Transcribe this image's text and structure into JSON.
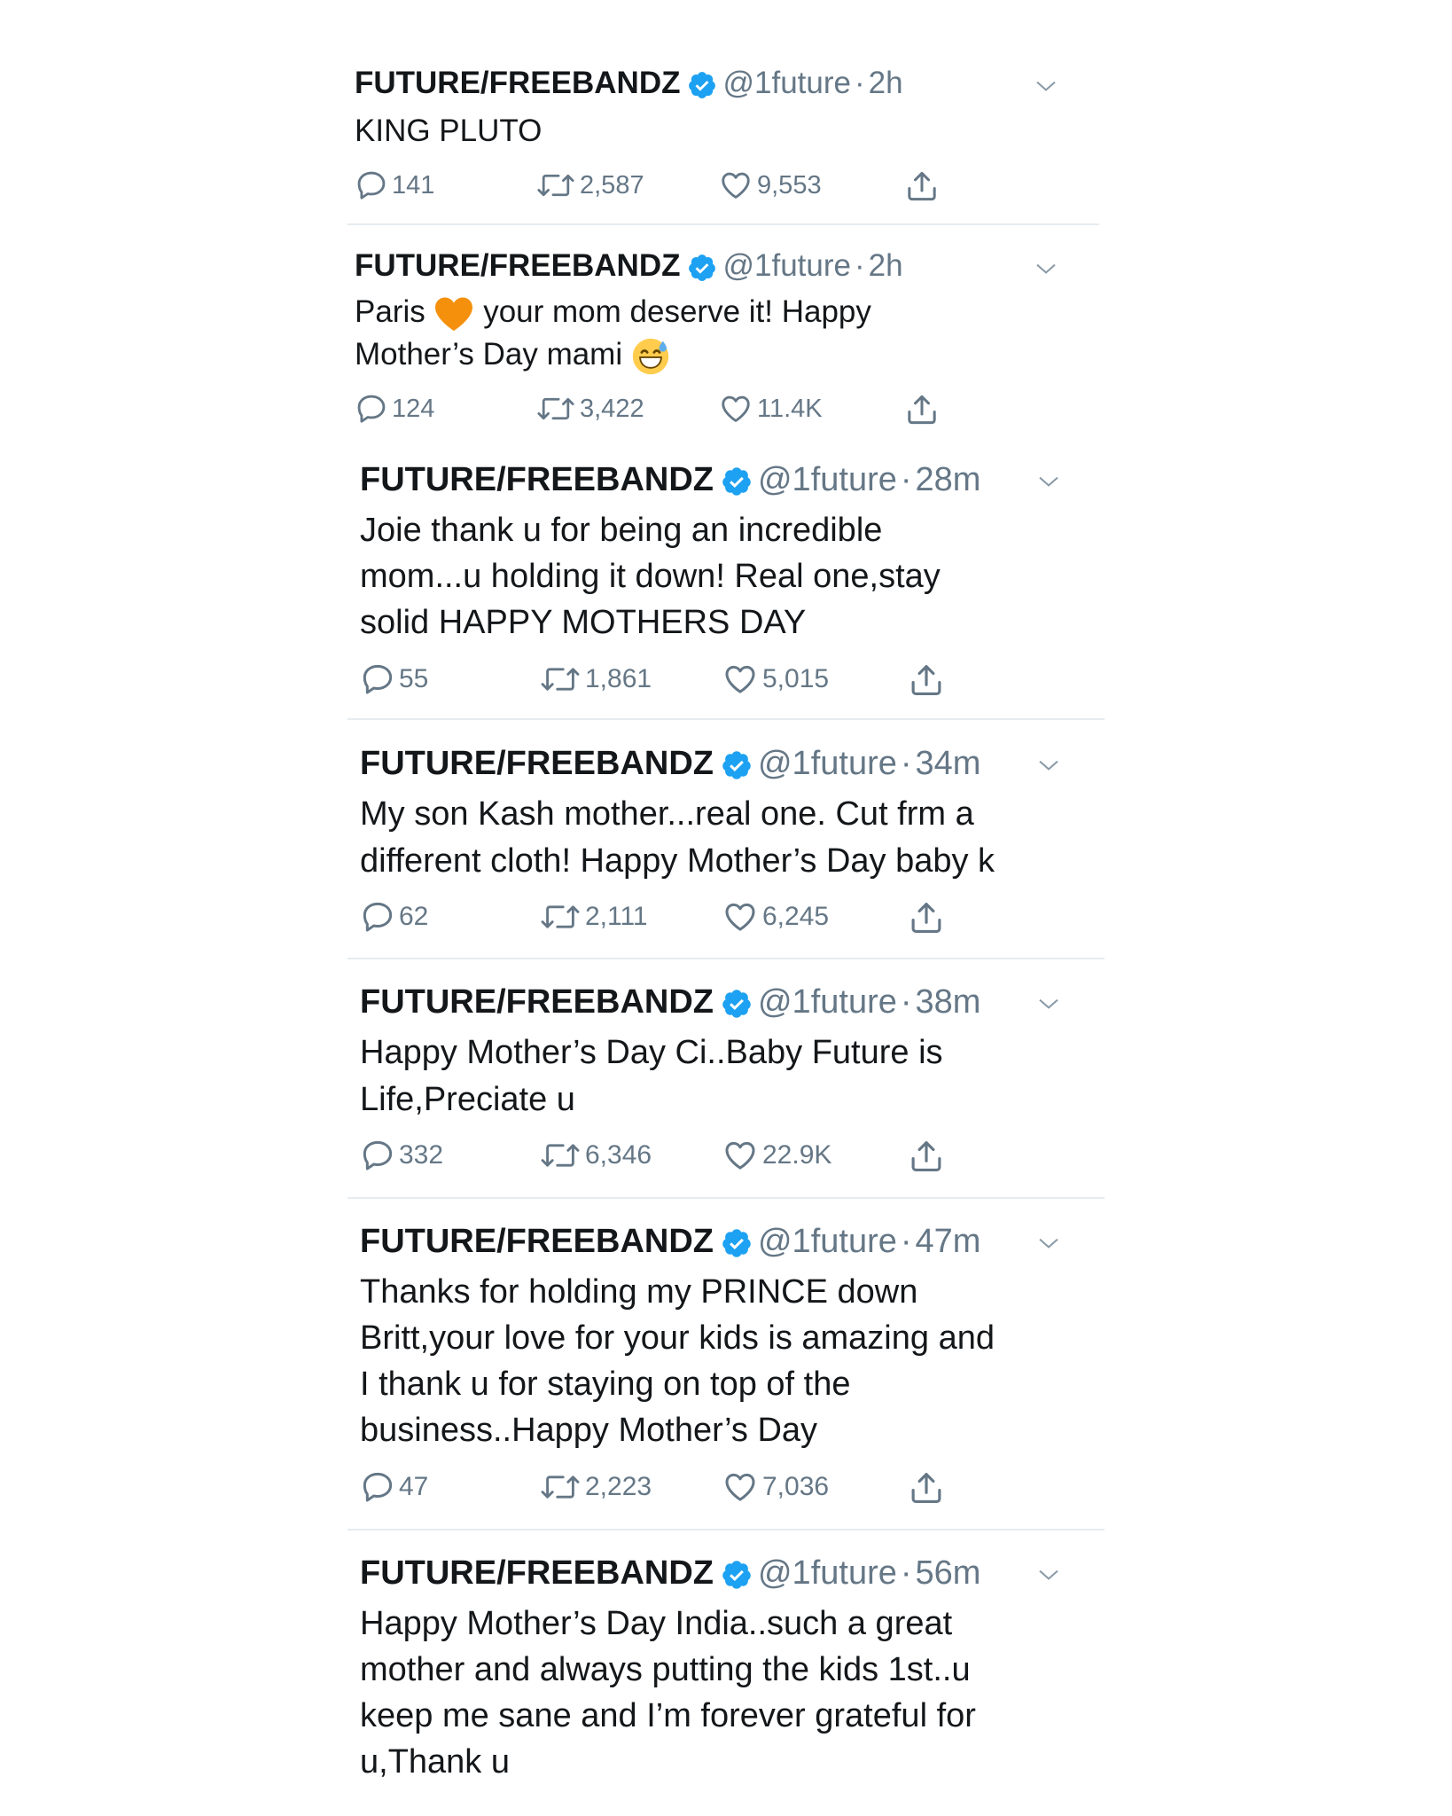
{
  "tweets": [
    {
      "name": "FUTURE/FREEBANDZ",
      "handle": "@1future",
      "time": "2h",
      "lines": [
        "KING PLUTO"
      ],
      "replies": "141",
      "retweets": "2,587",
      "likes": "9,553"
    },
    {
      "name": "FUTURE/FREEBANDZ",
      "handle": "@1future",
      "time": "2h",
      "line1_a": "Paris",
      "line1_emoji": "orange-heart-emoji",
      "line1_b": "your mom deserve it! Happy",
      "line2_a": "Mother’s Day mami",
      "line2_emoji": "grinning-sweat-emoji",
      "replies": "124",
      "retweets": "3,422",
      "likes": "11.4K"
    },
    {
      "name": "FUTURE/FREEBANDZ",
      "handle": "@1future",
      "time": "28m",
      "lines": [
        "Joie thank u for being an incredible",
        "mom...u holding it down! Real one,stay",
        "solid HAPPY MOTHERS DAY"
      ],
      "replies": "55",
      "retweets": "1,861",
      "likes": "5,015"
    },
    {
      "name": "FUTURE/FREEBANDZ",
      "handle": "@1future",
      "time": "34m",
      "lines": [
        "My son Kash mother...real one. Cut frm a",
        "different cloth! Happy Mother’s Day baby k"
      ],
      "replies": "62",
      "retweets": "2,111",
      "likes": "6,245"
    },
    {
      "name": "FUTURE/FREEBANDZ",
      "handle": "@1future",
      "time": "38m",
      "lines": [
        "Happy Mother’s Day Ci..Baby Future is",
        "Life,Preciate u"
      ],
      "replies": "332",
      "retweets": "6,346",
      "likes": "22.9K"
    },
    {
      "name": "FUTURE/FREEBANDZ",
      "handle": "@1future",
      "time": "47m",
      "lines": [
        "Thanks for holding my PRINCE down",
        "Britt,your love for your kids is amazing and",
        "I thank u for staying on top of the",
        "business..Happy Mother’s Day"
      ],
      "replies": "47",
      "retweets": "2,223",
      "likes": "7,036"
    },
    {
      "name": "FUTURE/FREEBANDZ",
      "handle": "@1future",
      "time": "56m",
      "lines": [
        "Happy Mother’s Day India..such a great",
        "mother and always putting the kids 1st..u",
        "keep me sane and I’m forever grateful for",
        "u,Thank u"
      ]
    }
  ],
  "separator": "·",
  "icons": {
    "verified": "verified-badge-icon",
    "caret": "chevron-down-icon",
    "reply": "reply-icon",
    "retweet": "retweet-icon",
    "like": "heart-icon",
    "share": "share-icon"
  },
  "colors": {
    "verified_blue": "#1da1f2",
    "text": "#14171a",
    "muted": "#657786",
    "divider": "#e6ecf0"
  }
}
